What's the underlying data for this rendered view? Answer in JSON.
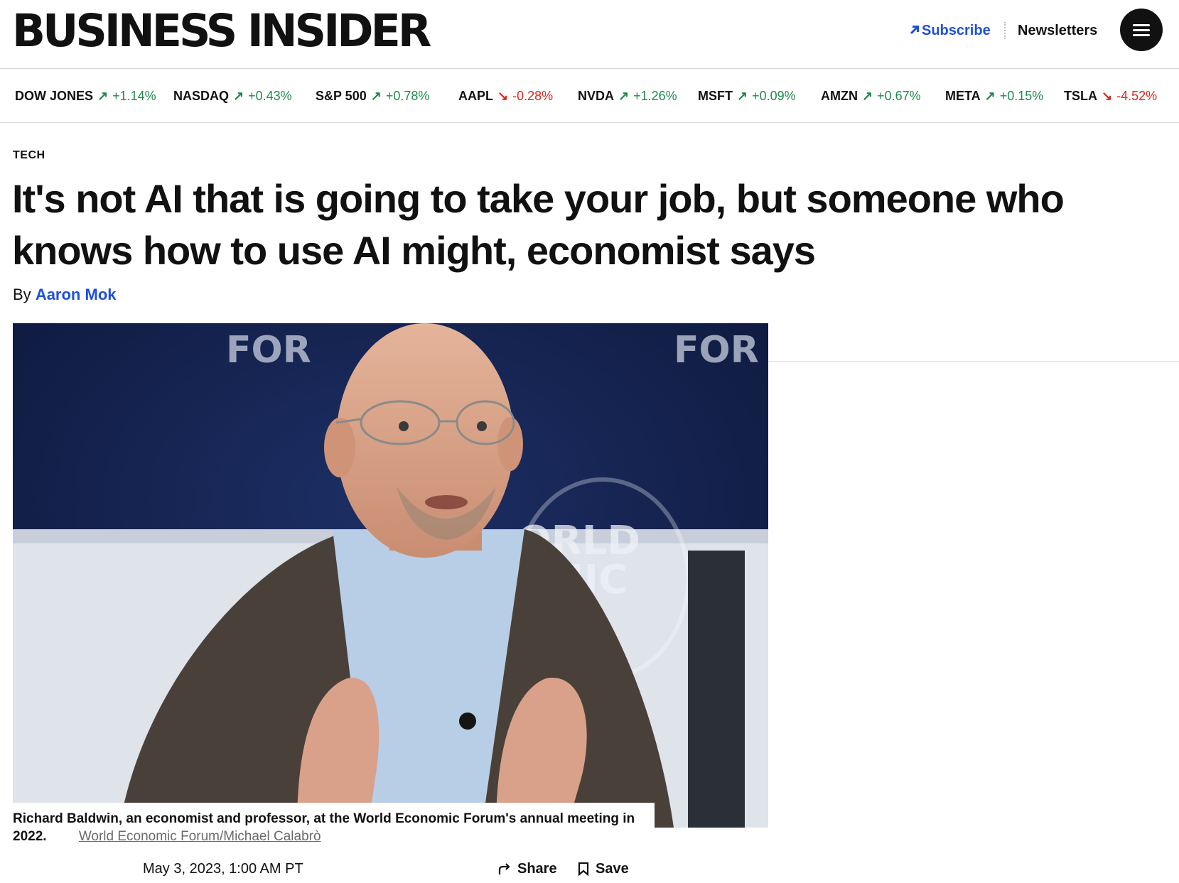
{
  "header": {
    "logo": "BUSINESS INSIDER",
    "subscribe_label": "Subscribe",
    "newsletters_label": "Newsletters",
    "menu_icon": "hamburger-menu-icon"
  },
  "ticker": [
    {
      "symbol": "DOW JONES",
      "change": "+1.14%",
      "direction": "up"
    },
    {
      "symbol": "NASDAQ",
      "change": "+0.43%",
      "direction": "up"
    },
    {
      "symbol": "S&P 500",
      "change": "+0.78%",
      "direction": "up"
    },
    {
      "symbol": "AAPL",
      "change": "-0.28%",
      "direction": "down"
    },
    {
      "symbol": "NVDA",
      "change": "+1.26%",
      "direction": "up"
    },
    {
      "symbol": "MSFT",
      "change": "+0.09%",
      "direction": "up"
    },
    {
      "symbol": "AMZN",
      "change": "+0.67%",
      "direction": "up"
    },
    {
      "symbol": "META",
      "change": "+0.15%",
      "direction": "up"
    },
    {
      "symbol": "TSLA",
      "change": "-4.52%",
      "direction": "down"
    }
  ],
  "article": {
    "category": "TECH",
    "headline": "It's not AI that is going to take your job, but someone who knows how to use AI might, economist says",
    "byline_prefix": "By",
    "author": "Aaron Mok",
    "image_caption": "Richard Baldwin, an economist and professor, at the World Economic Forum's annual meeting in 2022.",
    "image_credit": "World Economic Forum/Michael Calabrò",
    "date": "May 3, 2023, 1:00 AM PT",
    "share_label": "Share",
    "save_label": "Save"
  },
  "colors": {
    "accent_blue": "#1d4fe0",
    "up_green": "#1f8a4c",
    "down_red": "#e0261b",
    "text": "#111111"
  }
}
